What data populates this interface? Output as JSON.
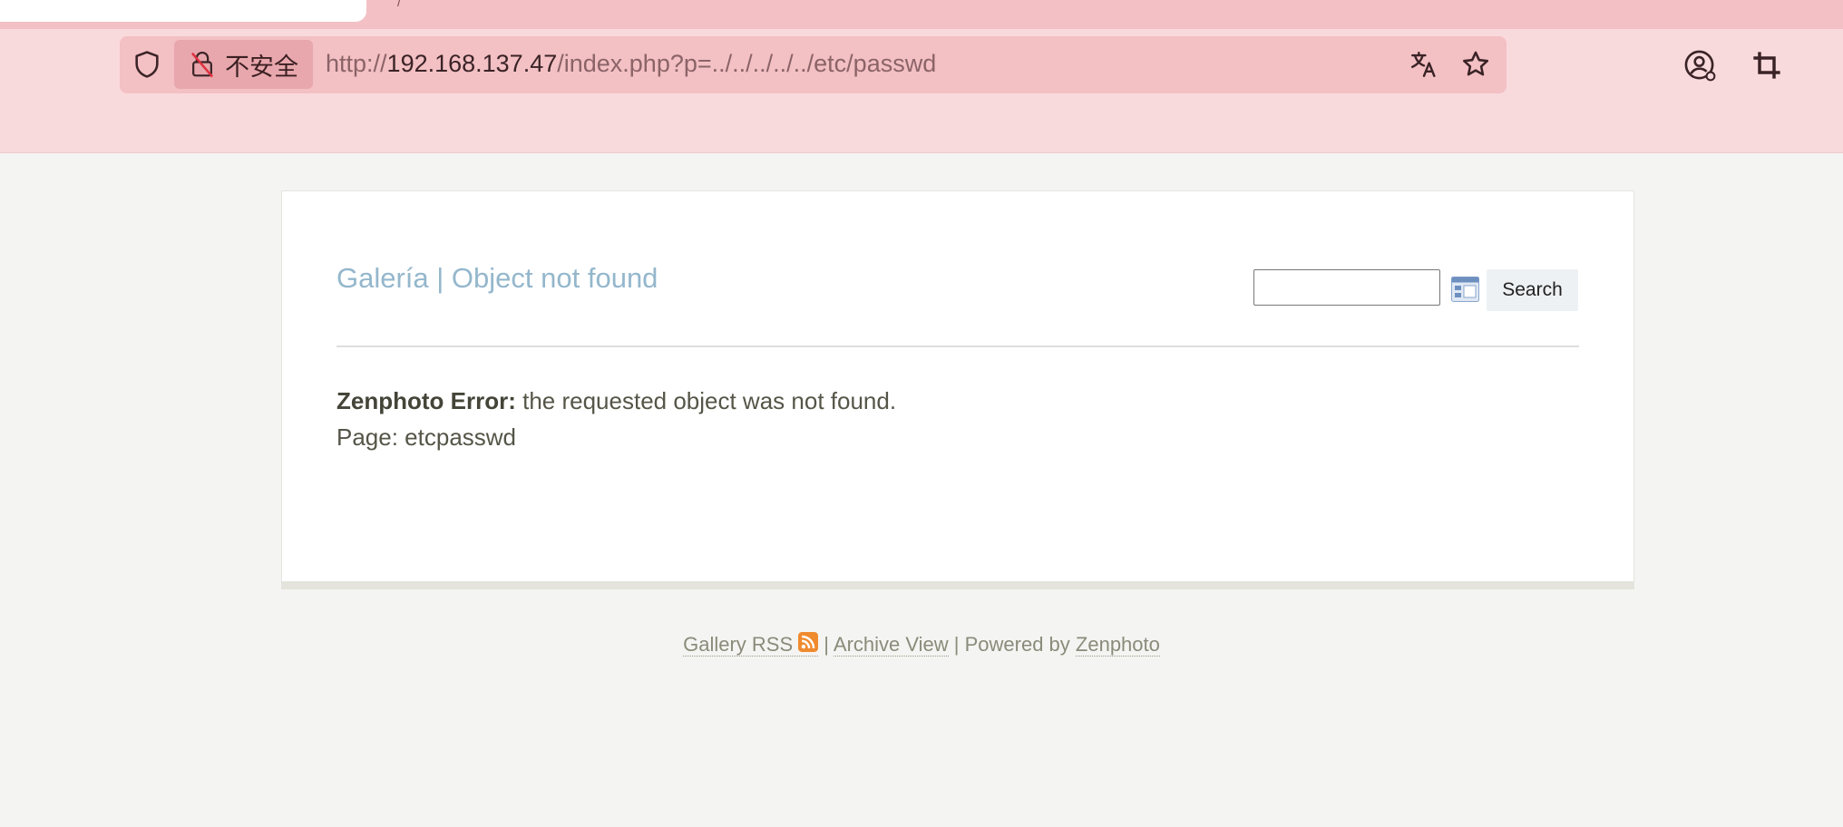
{
  "browser": {
    "tab_fragment": "/",
    "security_label": "不安全",
    "url": {
      "scheme": "http://",
      "host": "192.168.137.47",
      "path": "/index.php?p=../../../../../etc/passwd"
    }
  },
  "page": {
    "title": "Galería | Object not found",
    "search": {
      "value": "",
      "button_label": "Search"
    },
    "error": {
      "label": "Zenphoto Error:",
      "message": " the requested object was not found.",
      "page_line": "Page: etcpasswd"
    },
    "footer": {
      "rss_label": "Gallery RSS",
      "separator1": " | ",
      "archive_label": "Archive View",
      "separator2": " | Powered by ",
      "powered_label": "Zenphoto"
    }
  },
  "colors": {
    "chrome_tabstrip": "#f3c1c5",
    "chrome_toolbar": "#f9dadc",
    "title_blue": "#94b7cc",
    "rss_orange": "#f08a2e"
  },
  "icons": {
    "shield": "shield-icon",
    "insecure": "broken-lock-icon",
    "translate": "translate-icon",
    "bookmark": "star-icon",
    "account": "account-icon",
    "screenshot": "crop-icon",
    "search_options": "search-options-icon",
    "rss": "rss-icon"
  }
}
